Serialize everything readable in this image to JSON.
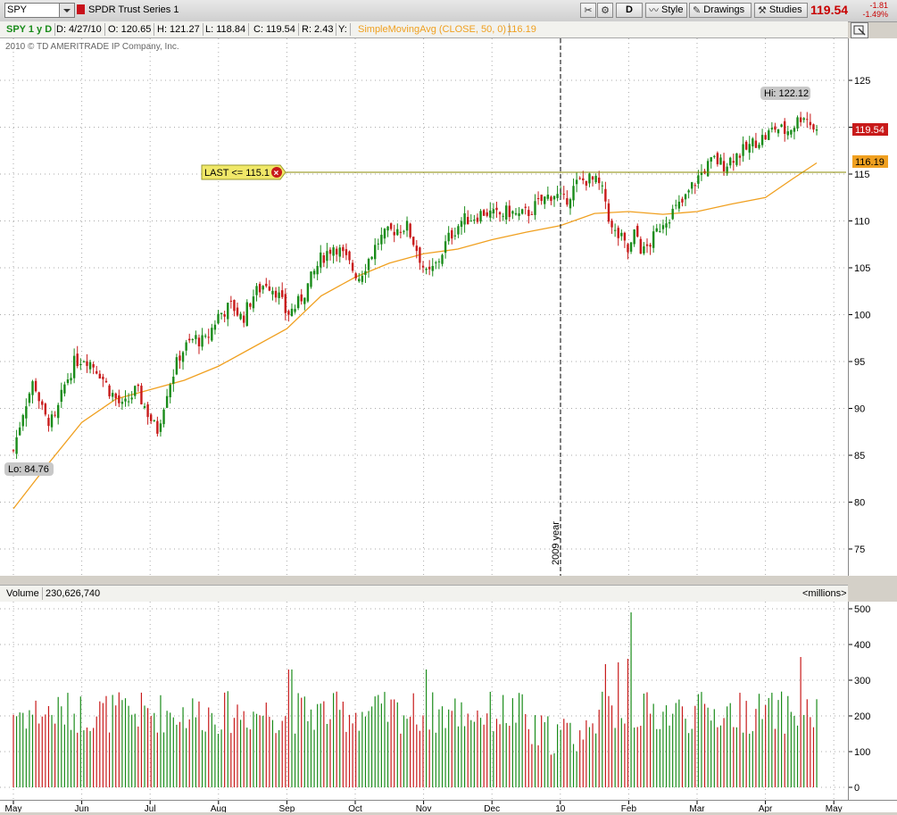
{
  "toolbar": {
    "symbol_value": "SPY",
    "description": "SPDR Trust Series 1",
    "aggregation": "D",
    "style_label": "Style",
    "drawings_label": "Drawings",
    "studies_label": "Studies",
    "last_price": "119.54",
    "change": "-1.81",
    "change_pct": "-1.49%"
  },
  "infobar": {
    "period": "SPY 1 y D",
    "date": "D: 4/27/10",
    "open": "O: 120.65",
    "high": "H: 121.27",
    "low": "L: 118.84",
    "close": "C: 119.54",
    "range": "R: 2.43",
    "y": "Y:",
    "study": "SimpleMovingAvg (CLOSE, 50, 0)",
    "study_value": "116.19"
  },
  "copyright": "2010 © TD AMERITRADE IP Company, Inc.",
  "annotations": {
    "hi_label": "Hi: 122.12",
    "lo_label": "Lo: 84.76",
    "alert_label": "LAST <= 115.1",
    "year_marker": "2009 year",
    "price_tag": "119.54",
    "sma_tag": "116.19"
  },
  "volume_header": {
    "label": "Volume",
    "value": "230,626,740",
    "units": "<millions>"
  },
  "colors": {
    "up": "#1a8c1a",
    "down": "#c81a1a",
    "sma": "#f0a020",
    "alert": "#f0e868"
  },
  "chart_data": {
    "type": "candlestick",
    "price_axis": {
      "ticks": [
        75,
        80,
        85,
        90,
        95,
        100,
        105,
        110,
        115,
        120,
        125
      ],
      "range": [
        71,
        128
      ]
    },
    "volume_axis": {
      "ticks": [
        0,
        100,
        200,
        300,
        400,
        500
      ],
      "range": [
        0,
        520
      ],
      "unit": "millions"
    },
    "x_ticks": [
      "May",
      "Jun",
      "Jul",
      "Aug",
      "Sep",
      "Oct",
      "Nov",
      "Dec",
      "10",
      "Feb",
      "Mar",
      "Apr",
      "May"
    ],
    "alert_level": 115.1,
    "hi": 122.12,
    "lo": 84.76,
    "close_path": [
      {
        "m": 0.0,
        "c": 85.5
      },
      {
        "m": 0.15,
        "c": 90
      },
      {
        "m": 0.3,
        "c": 93
      },
      {
        "m": 0.45,
        "c": 89
      },
      {
        "m": 0.6,
        "c": 88.5
      },
      {
        "m": 0.75,
        "c": 92.5
      },
      {
        "m": 0.9,
        "c": 95
      },
      {
        "m": 1.05,
        "c": 95.5
      },
      {
        "m": 1.25,
        "c": 94
      },
      {
        "m": 1.4,
        "c": 92
      },
      {
        "m": 1.6,
        "c": 90
      },
      {
        "m": 1.8,
        "c": 92
      },
      {
        "m": 2.0,
        "c": 89
      },
      {
        "m": 2.1,
        "c": 87.5
      },
      {
        "m": 2.25,
        "c": 92
      },
      {
        "m": 2.45,
        "c": 96
      },
      {
        "m": 2.65,
        "c": 97.5
      },
      {
        "m": 2.8,
        "c": 97
      },
      {
        "m": 3.0,
        "c": 100
      },
      {
        "m": 3.2,
        "c": 101
      },
      {
        "m": 3.35,
        "c": 99.5
      },
      {
        "m": 3.5,
        "c": 102
      },
      {
        "m": 3.7,
        "c": 103.5
      },
      {
        "m": 3.85,
        "c": 102.5
      },
      {
        "m": 4.0,
        "c": 100
      },
      {
        "m": 4.15,
        "c": 101
      },
      {
        "m": 4.3,
        "c": 103
      },
      {
        "m": 4.5,
        "c": 106
      },
      {
        "m": 4.7,
        "c": 107.5
      },
      {
        "m": 4.85,
        "c": 106
      },
      {
        "m": 5.05,
        "c": 104
      },
      {
        "m": 5.2,
        "c": 106
      },
      {
        "m": 5.35,
        "c": 108
      },
      {
        "m": 5.55,
        "c": 109
      },
      {
        "m": 5.75,
        "c": 109.5
      },
      {
        "m": 5.9,
        "c": 107
      },
      {
        "m": 6.05,
        "c": 104
      },
      {
        "m": 6.2,
        "c": 105.5
      },
      {
        "m": 6.35,
        "c": 108
      },
      {
        "m": 6.55,
        "c": 110
      },
      {
        "m": 6.75,
        "c": 110.5
      },
      {
        "m": 6.9,
        "c": 111
      },
      {
        "m": 7.05,
        "c": 110.5
      },
      {
        "m": 7.25,
        "c": 111
      },
      {
        "m": 7.4,
        "c": 110.5
      },
      {
        "m": 7.55,
        "c": 111
      },
      {
        "m": 7.7,
        "c": 112
      },
      {
        "m": 7.9,
        "c": 113
      },
      {
        "m": 8.05,
        "c": 112
      },
      {
        "m": 8.25,
        "c": 114
      },
      {
        "m": 8.4,
        "c": 114.5
      },
      {
        "m": 8.55,
        "c": 114
      },
      {
        "m": 8.65,
        "c": 112.5
      },
      {
        "m": 8.75,
        "c": 109
      },
      {
        "m": 8.9,
        "c": 108
      },
      {
        "m": 9.0,
        "c": 106.5
      },
      {
        "m": 9.1,
        "c": 109
      },
      {
        "m": 9.2,
        "c": 106.5
      },
      {
        "m": 9.35,
        "c": 108
      },
      {
        "m": 9.5,
        "c": 110
      },
      {
        "m": 9.65,
        "c": 111
      },
      {
        "m": 9.8,
        "c": 112
      },
      {
        "m": 9.95,
        "c": 114
      },
      {
        "m": 10.1,
        "c": 115.5
      },
      {
        "m": 10.25,
        "c": 116.5
      },
      {
        "m": 10.4,
        "c": 116
      },
      {
        "m": 10.55,
        "c": 117
      },
      {
        "m": 10.7,
        "c": 117.5
      },
      {
        "m": 10.85,
        "c": 118.5
      },
      {
        "m": 11.0,
        "c": 119
      },
      {
        "m": 11.15,
        "c": 120
      },
      {
        "m": 11.3,
        "c": 119.5
      },
      {
        "m": 11.45,
        "c": 120.5
      },
      {
        "m": 11.55,
        "c": 121.5
      },
      {
        "m": 11.65,
        "c": 120.5
      },
      {
        "m": 11.75,
        "c": 119.5
      }
    ],
    "sma_path": [
      {
        "m": 0.0,
        "c": 79.3
      },
      {
        "m": 0.5,
        "c": 84
      },
      {
        "m": 1.0,
        "c": 88.5
      },
      {
        "m": 1.5,
        "c": 91
      },
      {
        "m": 2.0,
        "c": 92
      },
      {
        "m": 2.5,
        "c": 93
      },
      {
        "m": 3.0,
        "c": 94.5
      },
      {
        "m": 3.5,
        "c": 96.5
      },
      {
        "m": 4.0,
        "c": 98.5
      },
      {
        "m": 4.5,
        "c": 102
      },
      {
        "m": 5.0,
        "c": 104
      },
      {
        "m": 5.5,
        "c": 105.5
      },
      {
        "m": 6.0,
        "c": 106.5
      },
      {
        "m": 6.5,
        "c": 107
      },
      {
        "m": 7.0,
        "c": 108
      },
      {
        "m": 7.5,
        "c": 108.8
      },
      {
        "m": 8.0,
        "c": 109.5
      },
      {
        "m": 8.5,
        "c": 110.8
      },
      {
        "m": 9.0,
        "c": 111
      },
      {
        "m": 9.5,
        "c": 110.7
      },
      {
        "m": 10.0,
        "c": 111
      },
      {
        "m": 10.5,
        "c": 111.8
      },
      {
        "m": 11.0,
        "c": 112.5
      },
      {
        "m": 11.4,
        "c": 114.5
      },
      {
        "m": 11.75,
        "c": 116.19
      }
    ],
    "volume_spikes": [
      {
        "m": 4.05,
        "v": 330
      },
      {
        "m": 6.05,
        "v": 330
      },
      {
        "m": 8.65,
        "v": 345
      },
      {
        "m": 8.85,
        "v": 350
      },
      {
        "m": 9.0,
        "v": 360
      },
      {
        "m": 9.05,
        "v": 490
      },
      {
        "m": 11.5,
        "v": 365
      }
    ]
  }
}
